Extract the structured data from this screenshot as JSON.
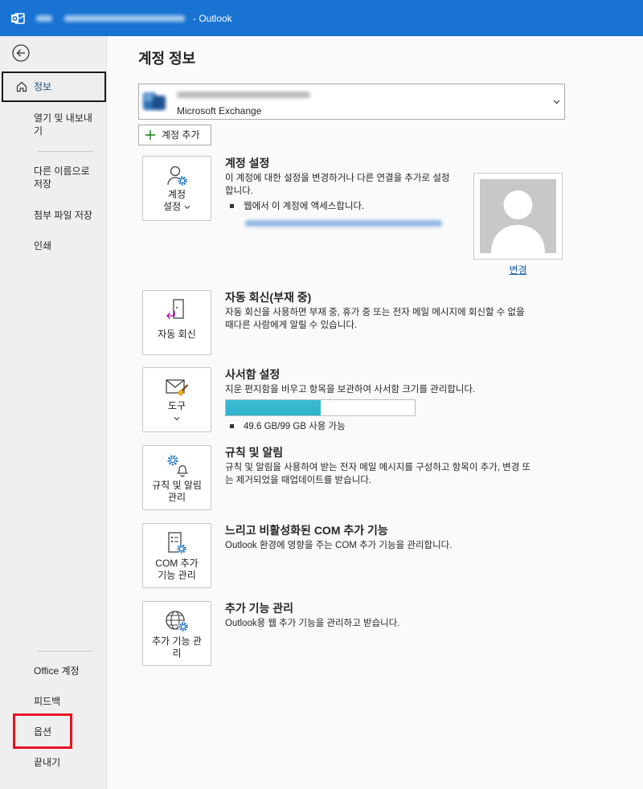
{
  "colors": {
    "titlebar": "#1873D3",
    "link": "#0F5CA8",
    "storage_fill": "#2FB3CB",
    "options_highlight": "#E81123",
    "add_icon": "#107C10"
  },
  "titlebar": {
    "app_icon": "outlook-icon",
    "suffix": "- Outlook"
  },
  "sidebar": {
    "back_icon": "back-arrow-icon",
    "items": [
      {
        "lines": [
          "정보"
        ],
        "icon": "home-icon",
        "selected": true
      },
      {
        "lines": [
          "열기 및 내보내",
          "기"
        ]
      },
      {
        "lines": [
          "다른 이름으로",
          "저장"
        ]
      },
      {
        "lines": [
          "첨부 파일 저장"
        ]
      },
      {
        "lines": [
          "인쇄"
        ]
      }
    ],
    "bottom_items": [
      {
        "lines": [
          "Office 계정"
        ]
      },
      {
        "lines": [
          "피드백"
        ]
      },
      {
        "lines": [
          "옵션"
        ],
        "highlighted": true
      },
      {
        "lines": [
          "끝내기"
        ]
      }
    ]
  },
  "main": {
    "title": "계정 정보",
    "account": {
      "type": "Microsoft Exchange",
      "dropdown_icon": "chevron-down-icon"
    },
    "add_account": {
      "icon": "plus-icon",
      "label": "계정 추가"
    },
    "sections": [
      {
        "icon": "account-settings-icon",
        "button_lines": [
          "계정",
          "설정"
        ],
        "button_has_dropdown": true,
        "title": "계정 설정",
        "description_lines": [
          "이 계정에 대한 설정을 변경하거나 다른 연결을 추가로 설정",
          "합니다."
        ],
        "bullet": "웹에서 이 계정에 액세스합니다."
      },
      {
        "icon": "automatic-replies-icon",
        "button_lines": [
          "자동 회신"
        ],
        "title": "자동 회신(부재 중)",
        "description_lines": [
          "자동 회신을 사용하면 부재 중, 휴가 중 또는 전자 메일 메시지에 회신할 수 없을",
          "때다른 사람에게 알릴 수 있습니다."
        ]
      },
      {
        "icon": "mailbox-tools-icon",
        "button_lines": [
          "도구"
        ],
        "button_has_dropdown": true,
        "title": "사서함 설정",
        "description_lines": [
          "지운 편지함을 비우고 항목을 보관하여 사서함 크기를 관리합니다."
        ],
        "storage": {
          "fill_fraction": 0.5,
          "label": "49.6 GB/99 GB 사용 가능"
        }
      },
      {
        "icon": "rules-alerts-icon",
        "button_lines": [
          "규칙 및 알림",
          "관리"
        ],
        "title": "규칙 및 알림",
        "description_lines": [
          "규칙 및 알림을 사용하여 받는 전자 메일 메시지를 구성하고 항목이 추가, 변경 또",
          "는 제거되었을 때업데이트를 받습니다."
        ]
      },
      {
        "icon": "com-addins-icon",
        "button_lines": [
          "COM 추가",
          "기능 관리"
        ],
        "title": "느리고 비활성화된 COM 추가 기능",
        "description_lines": [
          "Outlook 환경에 영향을 주는 COM 추가 기능을 관리합니다."
        ]
      },
      {
        "icon": "manage-addins-icon",
        "button_lines": [
          "추가 기능 관",
          "리"
        ],
        "title": "추가 기능 관리",
        "description_lines": [
          "Outlook용 웹 추가 기능을 관리하고 받습니다."
        ]
      }
    ],
    "profile_photo": {
      "change_link": "변경"
    }
  }
}
